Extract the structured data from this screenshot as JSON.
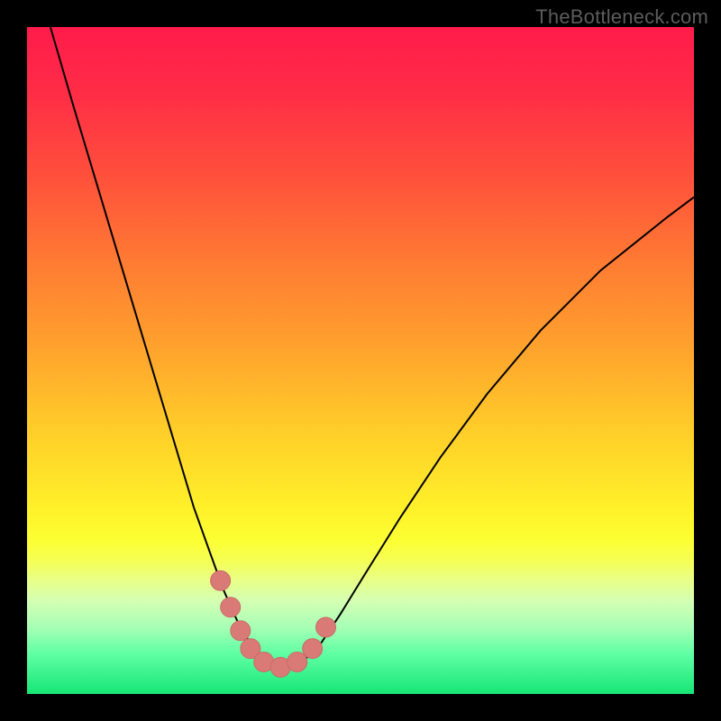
{
  "watermark": "TheBottleneck.com",
  "colors": {
    "frame": "#000000",
    "curve": "#000000",
    "marker_fill": "#d97a76",
    "marker_stroke": "#c96b67",
    "gradient_stops": [
      {
        "offset": 0.0,
        "color": "#ff1b4b"
      },
      {
        "offset": 0.1,
        "color": "#ff2d46"
      },
      {
        "offset": 0.22,
        "color": "#ff4f3c"
      },
      {
        "offset": 0.35,
        "color": "#ff7a33"
      },
      {
        "offset": 0.48,
        "color": "#ffa22d"
      },
      {
        "offset": 0.6,
        "color": "#ffcc29"
      },
      {
        "offset": 0.72,
        "color": "#fff029"
      },
      {
        "offset": 0.77,
        "color": "#fcff33"
      },
      {
        "offset": 0.8,
        "color": "#f5ff55"
      },
      {
        "offset": 0.83,
        "color": "#e8ff88"
      },
      {
        "offset": 0.86,
        "color": "#d5ffb3"
      },
      {
        "offset": 0.9,
        "color": "#a7ffb6"
      },
      {
        "offset": 0.94,
        "color": "#5fffa3"
      },
      {
        "offset": 1.0,
        "color": "#17e676"
      }
    ]
  },
  "chart_data": {
    "type": "line",
    "title": "",
    "xlabel": "",
    "ylabel": "",
    "xlim": [
      0,
      1
    ],
    "ylim": [
      0,
      1
    ],
    "series": [
      {
        "name": "bottleneck-curve",
        "x": [
          0.035,
          0.07,
          0.1,
          0.13,
          0.16,
          0.19,
          0.22,
          0.25,
          0.275,
          0.295,
          0.315,
          0.335,
          0.355,
          0.375,
          0.395,
          0.415,
          0.44,
          0.47,
          0.51,
          0.56,
          0.62,
          0.69,
          0.77,
          0.86,
          0.96,
          1.0
        ],
        "y": [
          1.0,
          0.88,
          0.78,
          0.68,
          0.58,
          0.48,
          0.38,
          0.28,
          0.21,
          0.155,
          0.11,
          0.075,
          0.05,
          0.038,
          0.038,
          0.05,
          0.075,
          0.12,
          0.185,
          0.265,
          0.355,
          0.45,
          0.545,
          0.635,
          0.715,
          0.745
        ]
      }
    ],
    "markers": {
      "name": "highlighted-points",
      "x": [
        0.29,
        0.305,
        0.32,
        0.335,
        0.355,
        0.38,
        0.405,
        0.428,
        0.448
      ],
      "y": [
        0.17,
        0.13,
        0.095,
        0.068,
        0.048,
        0.04,
        0.048,
        0.068,
        0.1
      ]
    }
  }
}
